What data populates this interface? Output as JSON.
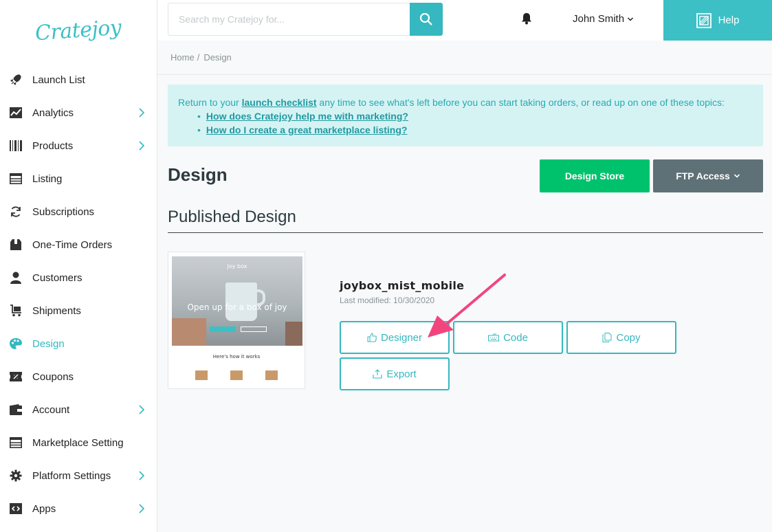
{
  "sidebar": {
    "logo": "Cratejoy",
    "items": [
      {
        "label": "Launch List",
        "icon": "rocket-icon",
        "chevron": false,
        "active": false
      },
      {
        "label": "Analytics",
        "icon": "chart-icon",
        "chevron": true,
        "active": false
      },
      {
        "label": "Products",
        "icon": "barcode-icon",
        "chevron": true,
        "active": false
      },
      {
        "label": "Listing",
        "icon": "list-icon",
        "chevron": false,
        "active": false
      },
      {
        "label": "Subscriptions",
        "icon": "refresh-icon",
        "chevron": false,
        "active": false
      },
      {
        "label": "One-Time Orders",
        "icon": "package-icon",
        "chevron": false,
        "active": false
      },
      {
        "label": "Customers",
        "icon": "person-icon",
        "chevron": false,
        "active": false
      },
      {
        "label": "Shipments",
        "icon": "cart-icon",
        "chevron": false,
        "active": false
      },
      {
        "label": "Design",
        "icon": "palette-icon",
        "chevron": false,
        "active": true
      },
      {
        "label": "Coupons",
        "icon": "ticket-icon",
        "chevron": false,
        "active": false
      },
      {
        "label": "Account",
        "icon": "wallet-icon",
        "chevron": true,
        "active": false
      },
      {
        "label": "Marketplace Setting",
        "icon": "storefront-icon",
        "chevron": false,
        "active": false
      },
      {
        "label": "Platform Settings",
        "icon": "gear-icon",
        "chevron": true,
        "active": false
      },
      {
        "label": "Apps",
        "icon": "code-icon",
        "chevron": true,
        "active": false
      }
    ]
  },
  "header": {
    "search_placeholder": "Search my Cratejoy for...",
    "user_name": "John Smith",
    "help_label": "Help"
  },
  "breadcrumb": {
    "home": "Home",
    "separator": "/",
    "current": "Design"
  },
  "notice": {
    "prefix": "Return to your ",
    "link_text": "launch checklist",
    "suffix": " any time to see what's left before you can start taking orders, or read up on one of these topics:",
    "links": [
      "How does Cratejoy help me with marketing?",
      "How do I create a great marketplace listing?"
    ]
  },
  "main": {
    "title": "Design",
    "design_store_label": "Design Store",
    "ftp_access_label": "FTP Access",
    "section_title": "Published Design",
    "design": {
      "name": "joybox_mist_mobile",
      "modified": "Last modified: 10/30/2020",
      "thumbnail": {
        "brand": "Joy box",
        "headline": "Open up for a box of joy",
        "subheading": "Here's how it works"
      }
    },
    "actions": {
      "designer": "Designer",
      "code": "Code",
      "copy": "Copy",
      "export": "Export"
    }
  },
  "colors": {
    "accent": "#35b8bf",
    "help_bg": "#3cc0c6",
    "design_store_bg": "#00c26d",
    "ftp_bg": "#5e7176",
    "notice_bg": "#d6f3f4",
    "annotation_arrow": "#f2457e"
  }
}
